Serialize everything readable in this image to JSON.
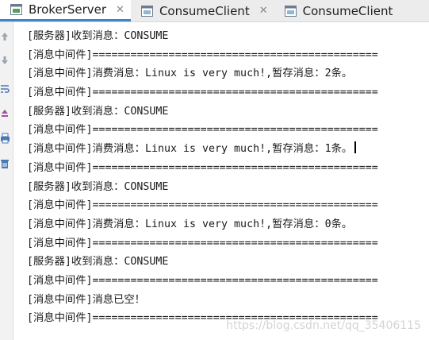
{
  "tabs": [
    {
      "label": "BrokerServer",
      "active": true,
      "icon": "console-icon",
      "close": "✕"
    },
    {
      "label": "ConsumeClient",
      "active": false,
      "icon": "console-icon",
      "close": "✕"
    },
    {
      "label": "ConsumeClient",
      "active": false,
      "icon": "console-icon",
      "close": ""
    }
  ],
  "gutter_icons": [
    "arrow-up-icon",
    "arrow-down-icon",
    "wrap-icon",
    "scroll-end-icon",
    "print-icon",
    "trash-icon"
  ],
  "console": {
    "lines": [
      "[服务器]收到消息：CONSUME",
      "[消息中间件]=============================================",
      "[消息中间件]消费消息：Linux is very much!,暂存消息：2条。",
      "[消息中间件]=============================================",
      "[服务器]收到消息：CONSUME",
      "[消息中间件]=============================================",
      "[消息中间件]消费消息：Linux is very much!,暂存消息：1条。",
      "[消息中间件]=============================================",
      "[服务器]收到消息：CONSUME",
      "[消息中间件]=============================================",
      "[消息中间件]消费消息：Linux is very much!,暂存消息：0条。",
      "[消息中间件]=============================================",
      "[服务器]收到消息：CONSUME",
      "[消息中间件]=============================================",
      "[消息中间件]消息已空！",
      "[消息中间件]============================================="
    ]
  },
  "watermark": "https://blog.csdn.net/qq_35406115",
  "colors": {
    "active_tab_underline": "#4083c9",
    "tabbar_bg": "#ececec",
    "text": "#1a1a1a"
  }
}
